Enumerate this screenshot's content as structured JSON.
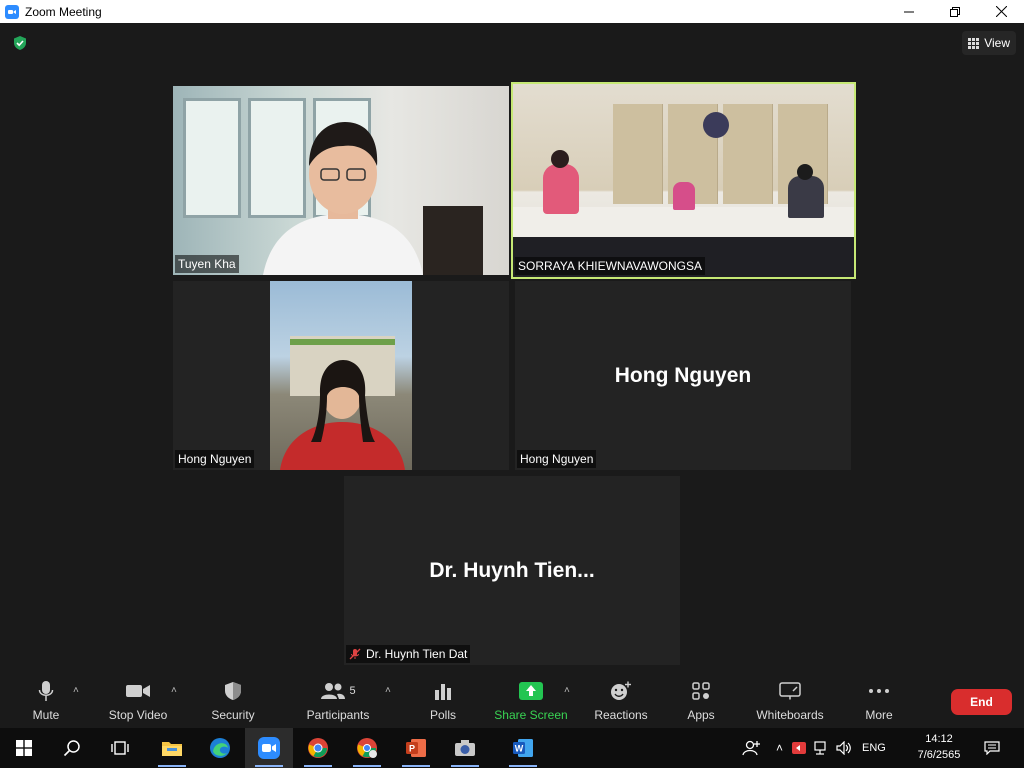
{
  "window": {
    "title": "Zoom Meeting"
  },
  "header": {
    "view_label": "View"
  },
  "tiles": {
    "tuyen": {
      "name": "Tuyen Kha"
    },
    "sorraya": {
      "name": "SORRAYA KHIEWNAVAWONGSA"
    },
    "hong_video": {
      "name": "Hong Nguyen"
    },
    "hong_novideo": {
      "name": "Hong Nguyen",
      "display": "Hong Nguyen"
    },
    "huynh": {
      "name": "Dr. Huynh Tien Dat",
      "display": "Dr. Huynh Tien..."
    }
  },
  "toolbar": {
    "mute": "Mute",
    "stop_video": "Stop Video",
    "security": "Security",
    "participants": "Participants",
    "participants_count": "5",
    "polls": "Polls",
    "share_screen": "Share Screen",
    "reactions": "Reactions",
    "apps": "Apps",
    "whiteboards": "Whiteboards",
    "more": "More",
    "end": "End"
  },
  "taskbar": {
    "language": "ENG",
    "time": "14:12",
    "date": "7/6/2565"
  },
  "colors": {
    "active_speaker": "#c6e875",
    "share_green": "#39d353",
    "end_red": "#d92d2d"
  }
}
